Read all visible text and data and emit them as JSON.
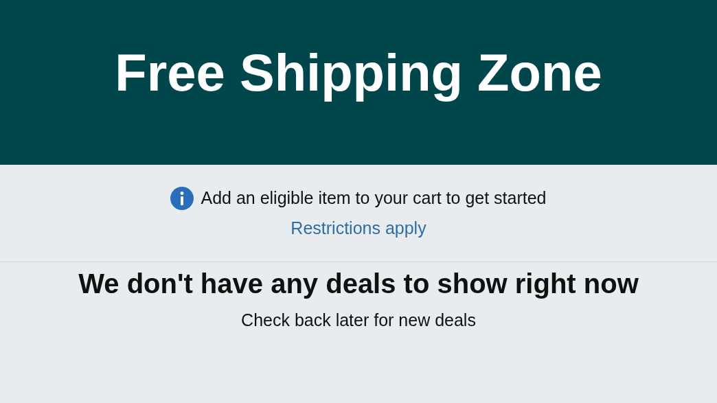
{
  "banner": {
    "title": "Free Shipping Zone"
  },
  "notice": {
    "text": "Add an eligible item to your cart to get started",
    "link": "Restrictions apply"
  },
  "empty_state": {
    "heading": "We don't have any deals to show right now",
    "subtext": "Check back later for new deals"
  }
}
